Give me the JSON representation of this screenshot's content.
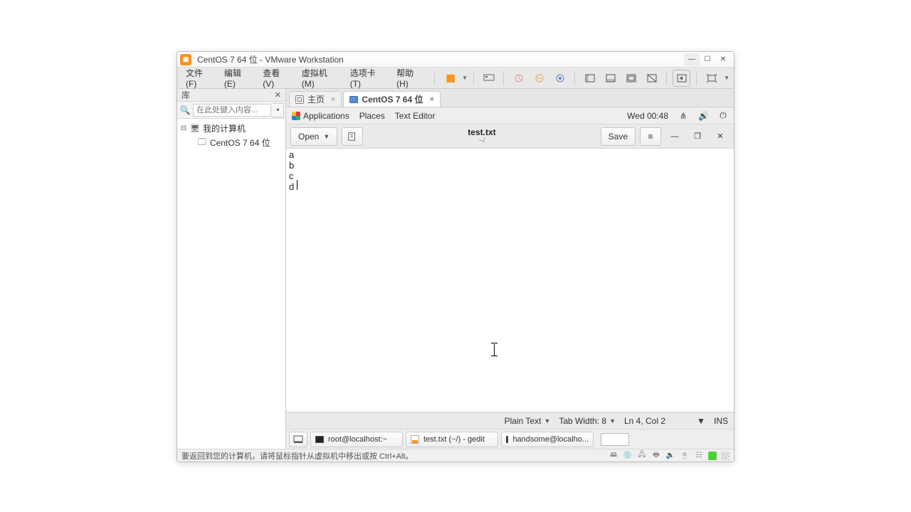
{
  "titlebar": {
    "title": "CentOS 7 64 位 - VMware Workstation"
  },
  "menu": {
    "file": "文件(F)",
    "edit": "编辑(E)",
    "view": "查看(V)",
    "vm": "虚拟机(M)",
    "tabs": "选项卡(T)",
    "help": "帮助(H)"
  },
  "sidebar": {
    "header": "库",
    "search_placeholder": "在此处键入内容...",
    "root": "我的计算机",
    "child": "CentOS 7 64 位"
  },
  "tabs": {
    "home": "主页",
    "vm": "CentOS 7 64 位"
  },
  "gnome": {
    "apps": "Applications",
    "places": "Places",
    "focused_app": "Text Editor",
    "clock": "Wed 00:48"
  },
  "gedit": {
    "open": "Open",
    "save": "Save",
    "filename": "test.txt",
    "filepath": "~/",
    "content": "a\nb\nc\nd",
    "status_plain": "Plain Text",
    "status_tab": "Tab Width: 8",
    "status_pos": "Ln 4, Col 2",
    "status_ins": "INS"
  },
  "taskbar": {
    "term1": "root@localhost:~",
    "gedit": "test.txt (~/) - gedit",
    "term2": "handsome@localho..."
  },
  "statusbar": {
    "message": "要返回到您的计算机，请将鼠标指针从虚拟机中移出或按 Ctrl+Alt。"
  }
}
